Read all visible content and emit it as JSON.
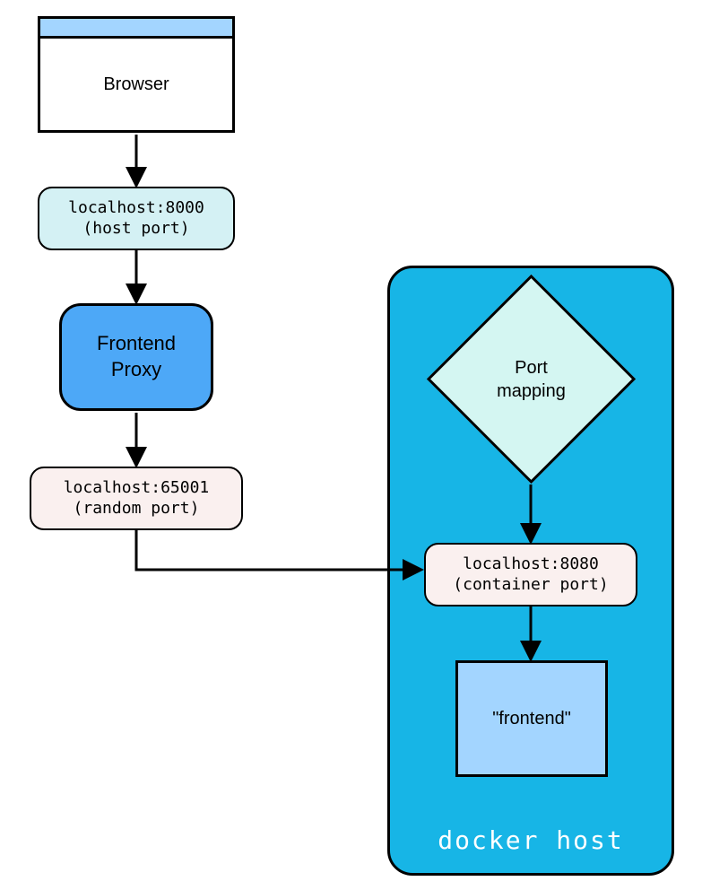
{
  "browser": {
    "label": "Browser"
  },
  "hostPort": {
    "line1": "localhost:8000",
    "line2": "(host port)"
  },
  "proxy": {
    "line1": "Frontend",
    "line2": "Proxy"
  },
  "randomPort": {
    "line1": "localhost:65001",
    "line2": "(random port)"
  },
  "dockerHost": {
    "label": "docker host"
  },
  "portMapping": {
    "line1": "Port",
    "line2": "mapping"
  },
  "containerPort": {
    "line1": "localhost:8080",
    "line2": "(container port)"
  },
  "frontend": {
    "label": "\"frontend\""
  }
}
